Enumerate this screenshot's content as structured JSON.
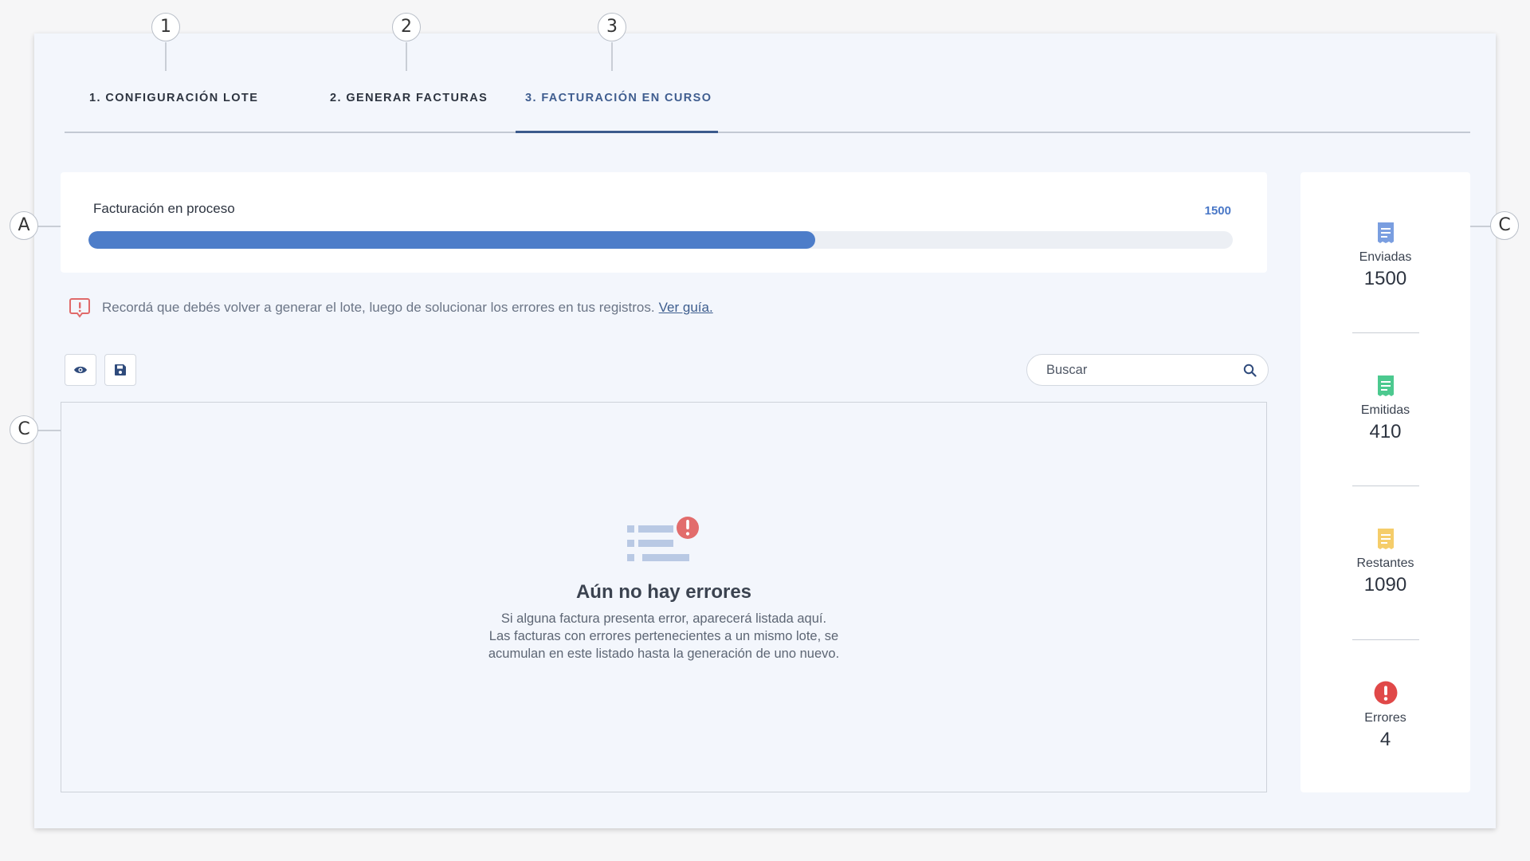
{
  "markers": {
    "step1": "1",
    "step2": "2",
    "step3": "3",
    "a": "A",
    "c_left": "C",
    "c_right": "C"
  },
  "tabs": [
    {
      "label": "1. CONFIGURACIÓN LOTE",
      "active": false
    },
    {
      "label": "2. GENERAR FACTURAS",
      "active": false
    },
    {
      "label": "3. FACTURACIÓN EN CURSO",
      "active": true
    }
  ],
  "progress": {
    "label": "Facturación en proceso",
    "value": "1500",
    "fraction": 0.635,
    "color": "#4d7dc9"
  },
  "alert": {
    "icon": "alert-speech-icon",
    "text": "Recordá que debés volver a generar el lote, luego de solucionar los errores en tus registros.",
    "link": "Ver guía."
  },
  "toolbar": {
    "view_icon": "eye-icon",
    "save_icon": "floppy-disk-icon",
    "search_placeholder": "Buscar",
    "search_icon": "search-icon"
  },
  "empty_state": {
    "icon": "list-error-icon",
    "title": "Aún no hay errores",
    "line1": "Si alguna factura presenta error, aparecerá listada aquí.",
    "line2": "Las facturas con errores pertenecientes a un mismo lote, se",
    "line3": "acumulan en este listado hasta la generación de uno nuevo."
  },
  "stats": [
    {
      "key": "enviadas",
      "label": "Enviadas",
      "value": "1500",
      "icon": "receipt-icon",
      "color": "#7a9ee0"
    },
    {
      "key": "emitidas",
      "label": "Emitidas",
      "value": "410",
      "icon": "receipt-icon",
      "color": "#4cc98f"
    },
    {
      "key": "restantes",
      "label": "Restantes",
      "value": "1090",
      "icon": "receipt-icon",
      "color": "#f5cd6a"
    },
    {
      "key": "errores",
      "label": "Errores",
      "value": "4",
      "icon": "error-icon",
      "color": "#e04848"
    }
  ]
}
